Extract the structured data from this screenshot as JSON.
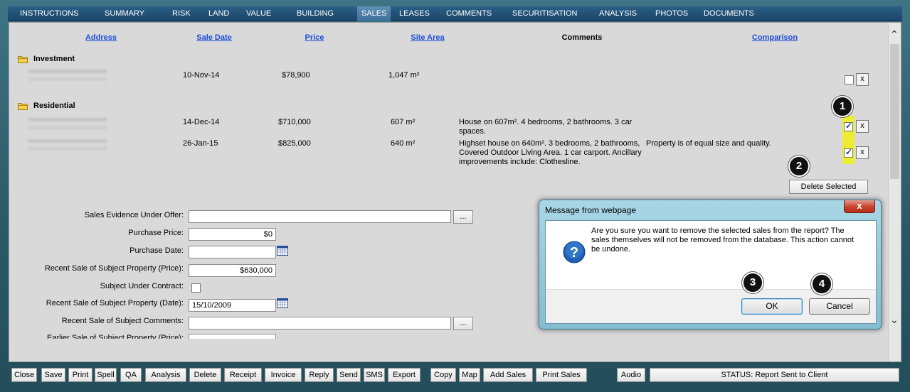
{
  "nav": {
    "items": [
      "INSTRUCTIONS",
      "SUMMARY",
      "RISK",
      "LAND",
      "VALUE",
      "BUILDING",
      "SALES",
      "LEASES",
      "COMMENTS",
      "SECURITISATION",
      "ANALYSIS",
      "PHOTOS",
      "DOCUMENTS"
    ],
    "active": "SALES"
  },
  "sales": {
    "headers": {
      "address": "Address",
      "sale_date": "Sale Date",
      "price": "Price",
      "site_area": "Site Area",
      "comments": "Comments",
      "comparison": "Comparison"
    },
    "groups": [
      {
        "label": "Investment",
        "rows": [
          {
            "sale_date": "10-Nov-14",
            "price": "$78,900",
            "site_area": "1,047 m²",
            "comments": "",
            "comparison": "",
            "checked": false
          }
        ]
      },
      {
        "label": "Residential",
        "rows": [
          {
            "sale_date": "14-Dec-14",
            "price": "$710,000",
            "site_area": "607 m²",
            "comments": "House on 607m². 4 bedrooms, 2 bathrooms. 3 car spaces.",
            "comparison": "",
            "checked": true
          },
          {
            "sale_date": "26-Jan-15",
            "price": "$825,000",
            "site_area": "640 m²",
            "comments": "Highset house on 640m². 3 bedrooms, 2 bathrooms, Covered Outdoor Living Area. 1 car carport. Ancillary improvements include: Clothesline.",
            "comparison": "Property is of equal size and quality.",
            "checked": true
          }
        ]
      }
    ],
    "remove_label": "x",
    "delete_selected": "Delete Selected"
  },
  "badges": [
    "1",
    "2",
    "3",
    "4"
  ],
  "form": {
    "sales_evidence_label": "Sales Evidence Under Offer:",
    "sales_evidence_value": "",
    "purchase_price_label": "Purchase Price:",
    "purchase_price_value": "$0",
    "purchase_date_label": "Purchase Date:",
    "purchase_date_value": "",
    "recent_sale_price_label": "Recent Sale of Subject Property (Price):",
    "recent_sale_price_value": "$630,000",
    "under_contract_label": "Subject Under Contract:",
    "recent_sale_date_label": "Recent Sale of Subject Property (Date):",
    "recent_sale_date_value": "15/10/2009",
    "recent_sale_comments_label": "Recent Sale of Subject Comments:",
    "recent_sale_comments_value": "",
    "earlier_sale_label": "Earlier Sale of Subject Property (Price):",
    "ellipsis": "..."
  },
  "dialog": {
    "title": "Message from webpage",
    "close": "x",
    "message": "Are you sure you want to remove the selected sales from the report? The sales themselves will not be removed from the database.  This action cannot be undone.",
    "ok": "OK",
    "cancel": "Cancel"
  },
  "toolbar": {
    "buttons": [
      "Close",
      "Save",
      "Print",
      "Spell",
      "QA",
      "Analysis",
      "Delete",
      "Receipt",
      "Invoice",
      "Reply",
      "Send",
      "SMS",
      "Export",
      "Copy",
      "Map",
      "Add Sales",
      "Print Sales",
      "Audio"
    ],
    "status": "STATUS: Report Sent to Client"
  },
  "colors": {
    "nav_bg": "#1b4668",
    "link": "#1c4ed8",
    "highlight": "#ecec30",
    "panel": "#d9d9d9",
    "dialog_frame": "#a9d6e6"
  }
}
